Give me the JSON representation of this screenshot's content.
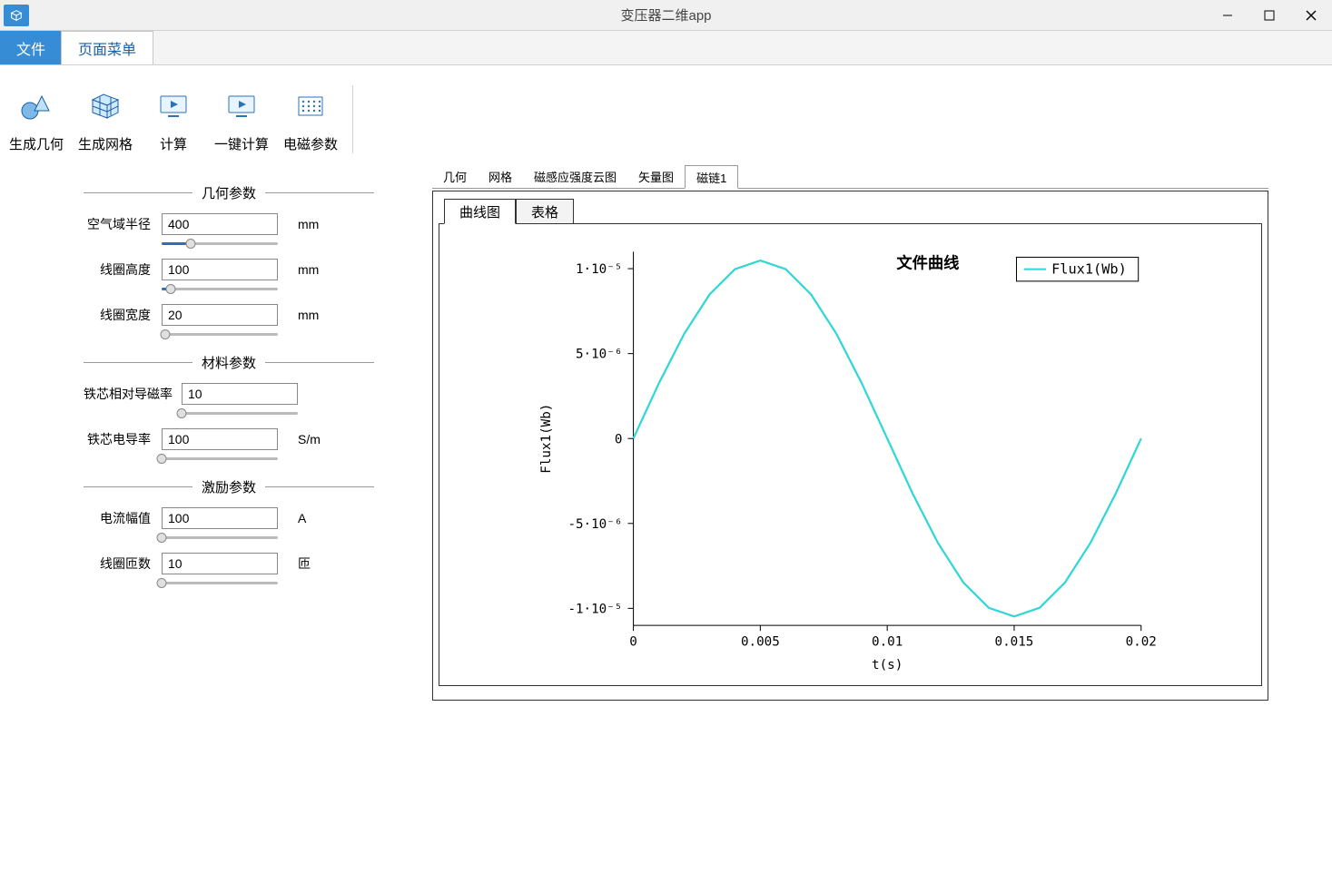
{
  "window": {
    "title": "变压器二维app"
  },
  "menubar": {
    "tabs": [
      {
        "label": "文件",
        "active": true
      },
      {
        "label": "页面菜单",
        "active": false
      }
    ]
  },
  "ribbon": {
    "generate_geometry": "生成几何",
    "generate_mesh": "生成网格",
    "compute": "计算",
    "one_click_compute": "一键计算",
    "em_params": "电磁参数"
  },
  "form": {
    "sections": {
      "geometry": "几何参数",
      "material": "材料参数",
      "excitation": "激励参数"
    },
    "air_radius": {
      "label": "空气域半径",
      "value": "400",
      "unit": "mm",
      "fill_pct": 25
    },
    "coil_height": {
      "label": "线圈高度",
      "value": "100",
      "unit": "mm",
      "fill_pct": 8
    },
    "coil_width": {
      "label": "线圈宽度",
      "value": "20",
      "unit": "mm",
      "fill_pct": 3
    },
    "core_rel_perm": {
      "label": "铁芯相对导磁率",
      "value": "10",
      "unit": "",
      "fill_pct": 0
    },
    "core_cond": {
      "label": "铁芯电导率",
      "value": "100",
      "unit": "S/m",
      "fill_pct": 0
    },
    "current_amp": {
      "label": "电流幅值",
      "value": "100",
      "unit": "A",
      "fill_pct": 0
    },
    "coil_turns": {
      "label": "线圈匝数",
      "value": "10",
      "unit": "匝",
      "fill_pct": 0
    }
  },
  "content_tabs": [
    "几何",
    "网格",
    "磁感应强度云图",
    "矢量图",
    "磁链1"
  ],
  "content_tabs_active": 4,
  "subtabs": {
    "curve": "曲线图",
    "table": "表格"
  },
  "chart_data": {
    "type": "line",
    "title": "文件曲线",
    "xlabel": "t(s)",
    "ylabel": "Flux1(Wb)",
    "legend": "Flux1(Wb)",
    "x_ticks": [
      0,
      0.005,
      0.01,
      0.015,
      0.02
    ],
    "y_ticks": [
      -1e-05,
      -5e-06,
      0,
      5e-06,
      1e-05
    ],
    "y_tick_labels": [
      "-1·10⁻⁵",
      "-5·10⁻⁶",
      "0",
      "5·10⁻⁶",
      "1·10⁻⁵"
    ],
    "xlim": [
      0,
      0.02
    ],
    "ylim": [
      -1.1e-05,
      1.1e-05
    ],
    "x": [
      0,
      0.001,
      0.002,
      0.003,
      0.004,
      0.005,
      0.006,
      0.007,
      0.008,
      0.009,
      0.01,
      0.011,
      0.012,
      0.013,
      0.014,
      0.015,
      0.016,
      0.017,
      0.018,
      0.019,
      0.02
    ],
    "values": [
      0,
      3.24e-06,
      6.16e-06,
      8.48e-06,
      9.97e-06,
      1.048e-05,
      9.97e-06,
      8.48e-06,
      6.16e-06,
      3.24e-06,
      0,
      -3.24e-06,
      -6.16e-06,
      -8.48e-06,
      -9.97e-06,
      -1.048e-05,
      -9.97e-06,
      -8.48e-06,
      -6.16e-06,
      -3.24e-06,
      0
    ]
  }
}
